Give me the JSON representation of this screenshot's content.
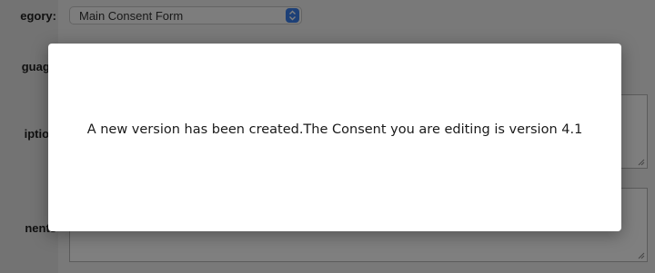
{
  "form": {
    "category_label": "egory:",
    "category_value": "Main Consent Form",
    "language_label": "guage",
    "description_label": "iption",
    "comments_label": "nents"
  },
  "dialog": {
    "message": "A new version has been created.The Consent you are editing is version 4.1"
  },
  "colors": {
    "stepper_accent": "#3a80ee",
    "modal_background": "#ffffff",
    "overlay": "rgba(0,0,0,0.5)"
  },
  "icons": {
    "stepper": "select-stepper-icon",
    "resize": "resize-handle-icon"
  }
}
